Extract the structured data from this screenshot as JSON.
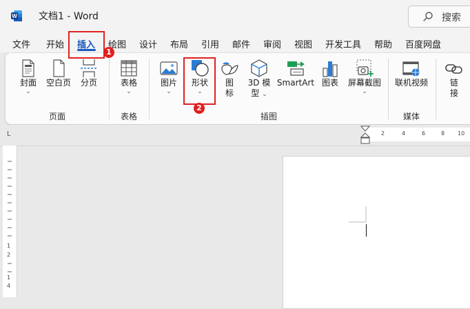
{
  "app": {
    "title": "文档1  -  Word"
  },
  "search": {
    "label": "搜索"
  },
  "tabs": [
    "文件",
    "开始",
    "插入",
    "绘图",
    "设计",
    "布局",
    "引用",
    "邮件",
    "审阅",
    "视图",
    "开发工具",
    "帮助",
    "百度网盘"
  ],
  "active_tab": "插入",
  "ribbon": {
    "pages": {
      "cover": "封面",
      "blank": "空白页",
      "break": "分页",
      "group": "页面"
    },
    "tables": {
      "table": "表格",
      "group": "表格"
    },
    "illustrations": {
      "pictures": "图片",
      "shapes": "形状",
      "icons_1": "图",
      "icons_2": "标",
      "model3d_1": "3D 模",
      "model3d_2": "型",
      "smartart": "SmartArt",
      "chart": "图表",
      "screenshot": "屏幕截图",
      "group": "插图"
    },
    "media": {
      "online_video": "联机视频",
      "group": "媒体"
    },
    "links": {
      "link_1": "链",
      "link_2": "接"
    }
  },
  "annotations": {
    "step1": "1",
    "step2": "2",
    "color": "#e02020"
  },
  "ruler": {
    "h_ticks": [
      "2",
      "4",
      "6",
      "8",
      "10"
    ],
    "v_ticks": [
      "1",
      "2",
      "1",
      "4"
    ],
    "corner": "L"
  },
  "colors": {
    "accent": "#185abd",
    "ribbon_bg": "#fbfbfb",
    "title_bg": "#f3f3f3"
  }
}
